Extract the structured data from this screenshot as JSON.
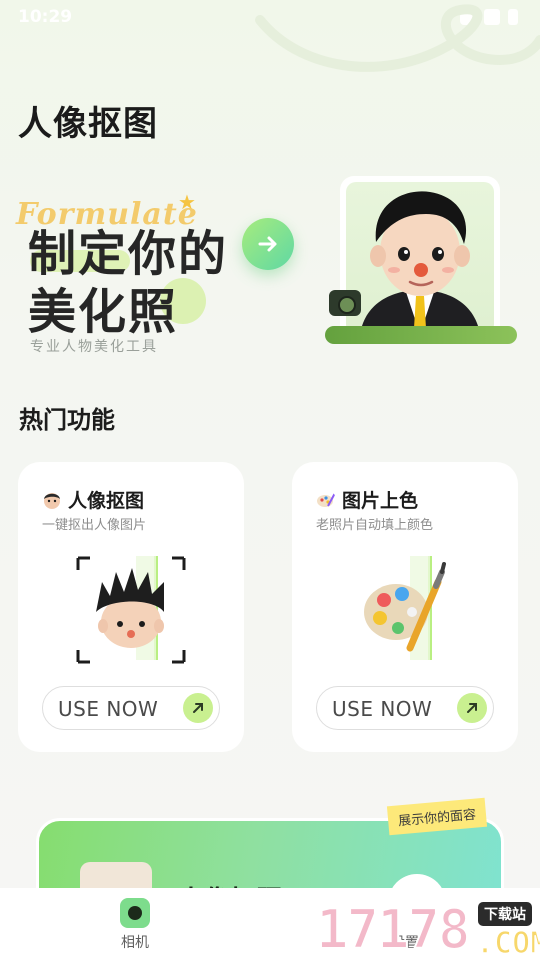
{
  "status_bar": {
    "time": "10:29"
  },
  "page": {
    "title": "人像抠图"
  },
  "hero": {
    "script_text": "Formulate",
    "line1": "制定你的",
    "line2": "美化照",
    "subtitle": "专业人物美化工具"
  },
  "hot_section": {
    "title": "热门功能"
  },
  "features": [
    {
      "title": "人像抠图",
      "subtitle": "一键抠出人像图片",
      "button_label": "USE NOW",
      "icon": "boy-avatar-emoji"
    },
    {
      "title": "图片上色",
      "subtitle": "老照片自动填上颜色",
      "button_label": "USE NOW",
      "icon": "paint-palette-emoji"
    }
  ],
  "banner": {
    "tag": "展示你的面容",
    "title": "人像抠照"
  },
  "bottom_nav": {
    "items": [
      {
        "label": "相机",
        "icon": "camera-icon"
      },
      {
        "label": "设置",
        "icon": "gear-icon"
      }
    ]
  },
  "watermark": {
    "digits": "17178",
    "tag": "下载站",
    "suffix": ".COM"
  },
  "colors": {
    "accent_green": "#7ddc8c",
    "use_now_arrow": "#c9f090",
    "banner_gradient_start": "#86dd6f",
    "banner_gradient_end": "#7fe3d2"
  }
}
